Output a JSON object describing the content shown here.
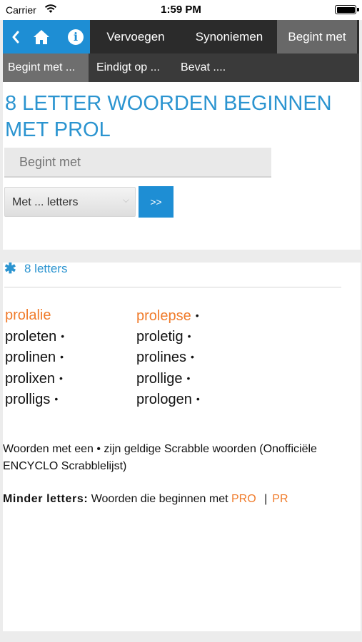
{
  "status_bar": {
    "carrier": "Carrier",
    "time": "1:59 PM"
  },
  "nav": {
    "back_icon": "chevron-left-icon",
    "home_icon": "home-icon",
    "info_icon": "info-icon",
    "tabs": [
      "Vervoegen",
      "Synoniemen",
      "Begint met"
    ],
    "active_tab": "Begint met",
    "subtabs": [
      "Begint met ...",
      "Eindigt op ...",
      "Bevat ...."
    ],
    "active_subtab": "Begint met ..."
  },
  "colors": {
    "accent": "#1e8ed4",
    "title": "#2b94d0",
    "highlight": "#f07c2c",
    "nav_dark": "#2b2b2b"
  },
  "main": {
    "title": "8 LETTER WOORDEN BEGINNEN MET PROL",
    "search_placeholder": "Begint met",
    "letters_select": "Met ... letters",
    "go_button": ">>"
  },
  "results": {
    "count_icon": "asterisk-icon",
    "count_label": "8 letters",
    "bullet": "•",
    "columns": [
      [
        "prolalie",
        "proleten",
        "prolinen",
        "prolixen",
        "prolligs"
      ],
      [
        "prolepse",
        "proletig",
        "prolines",
        "prollige",
        "prologen"
      ]
    ],
    "highlighted": [
      "prolalie",
      "prolepse"
    ],
    "legend": "Woorden met een • zijn geldige Scrabble woorden (Onofficiële ENCYCLO Scrabblelijst)",
    "less_letters_label": "Minder letters:",
    "less_letters_text": "Woorden die beginnen met",
    "less_links": [
      "PRO",
      "PR"
    ],
    "less_sep": "|"
  }
}
